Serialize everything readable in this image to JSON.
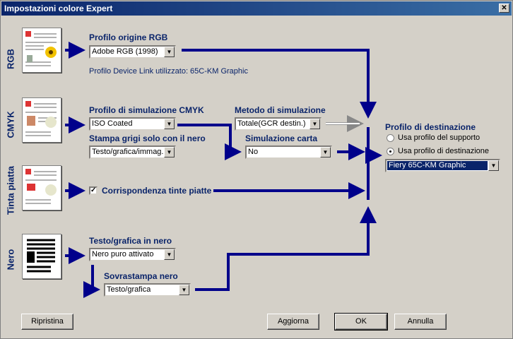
{
  "window": {
    "title": "Impostazioni colore Expert",
    "close_glyph": "✕"
  },
  "sections": {
    "rgb": "RGB",
    "cmyk": "CMYK",
    "spot": "Tinta piatta",
    "black": "Nero"
  },
  "rgb": {
    "label": "Profilo origine RGB",
    "value": "Adobe RGB (1998)",
    "devicelink_note": "Profilo Device Link utilizzato: 65C-KM Graphic"
  },
  "cmyk": {
    "sim_label": "Profilo di simulazione CMYK",
    "sim_value": "ISO Coated",
    "method_label": "Metodo di simulazione",
    "method_value": "Totale(GCR destin.)",
    "gray_label": "Stampa grigi solo con il nero",
    "gray_value": "Testo/grafica/immag.",
    "paper_label": "Simulazione carta",
    "paper_value": "No"
  },
  "spot": {
    "label": "Corrispondenza tinte piatte",
    "checked_glyph": "✓"
  },
  "black": {
    "text_label": "Testo/grafica in nero",
    "text_value": "Nero puro attivato",
    "overprint_label": "Sovrastampa nero",
    "overprint_value": "Testo/grafica"
  },
  "destination": {
    "label": "Profilo di destinazione",
    "opt1": "Usa profilo del supporto",
    "opt2": "Usa profilo di destinazione",
    "selected": "opt2",
    "value": "Fiery 65C-KM Graphic"
  },
  "buttons": {
    "reset": "Ripristina",
    "update": "Aggiorna",
    "ok": "OK",
    "cancel": "Annulla"
  },
  "dropdown_glyph": "▼",
  "colors": {
    "accent": "#0a246a",
    "arrow": "#00008b"
  }
}
